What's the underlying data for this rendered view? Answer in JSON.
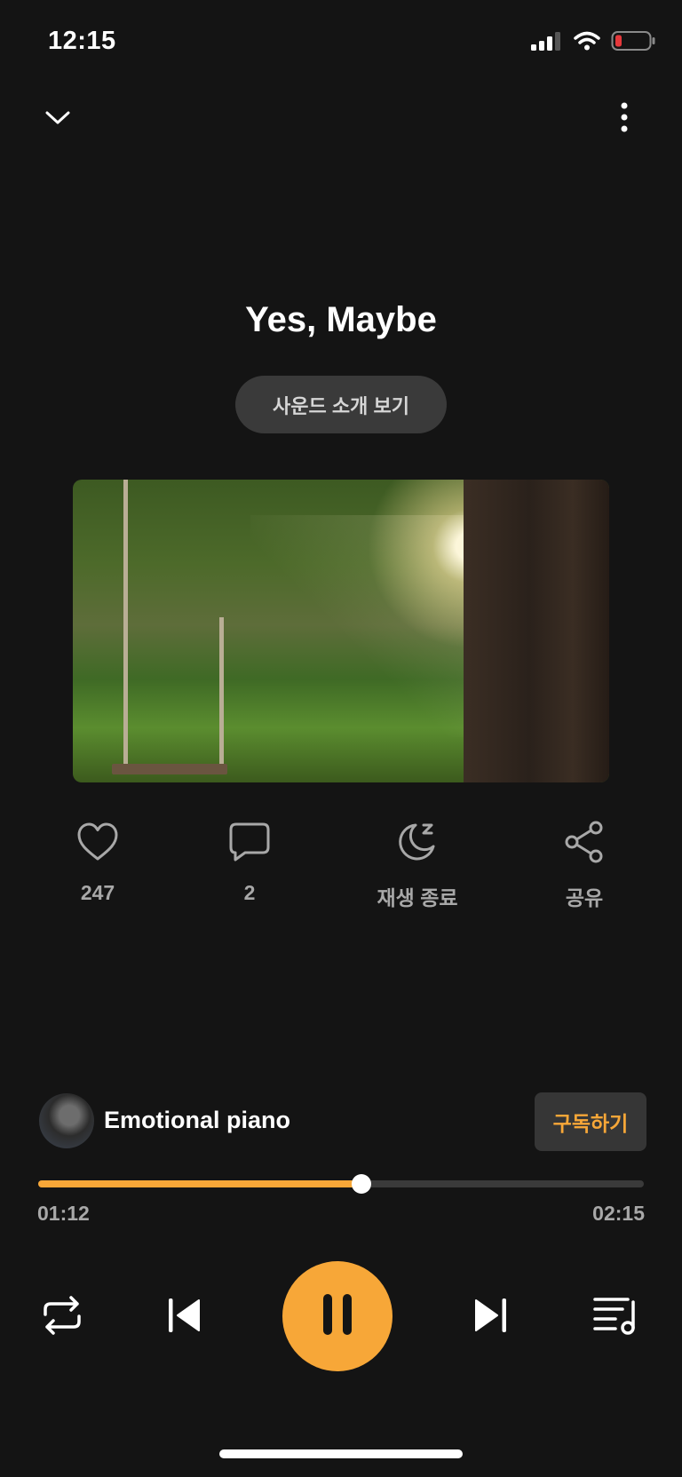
{
  "status_bar": {
    "time": "12:15",
    "icons": [
      "cellular-signal-icon",
      "wifi-icon",
      "battery-low-icon"
    ]
  },
  "nav": {
    "collapse_icon": "chevron-down-icon",
    "more_icon": "more-vertical-icon"
  },
  "track": {
    "title": "Yes, Maybe",
    "intro_button": "사운드 소개 보기",
    "artwork": "forest-swing-artwork"
  },
  "actions": [
    {
      "icon": "heart-icon",
      "label": "247"
    },
    {
      "icon": "comment-icon",
      "label": "2"
    },
    {
      "icon": "sleep-timer-icon",
      "label": "재생 종료"
    },
    {
      "icon": "share-icon",
      "label": "공유"
    }
  ],
  "artist": {
    "name": "Emotional piano",
    "subscribe_label": "구독하기"
  },
  "playback": {
    "current_time": "01:12",
    "total_time": "02:15",
    "progress": 0.533,
    "state": "playing"
  },
  "controls": {
    "repeat_icon": "repeat-icon",
    "previous_icon": "skip-previous-icon",
    "play_pause_icon": "pause-icon",
    "next_icon": "skip-next-icon",
    "playlist_icon": "playlist-icon"
  },
  "colors": {
    "background": "#141414",
    "accent": "#f7a738",
    "secondary_text": "#a8a8a8",
    "pill_background": "#3a3a3a"
  }
}
